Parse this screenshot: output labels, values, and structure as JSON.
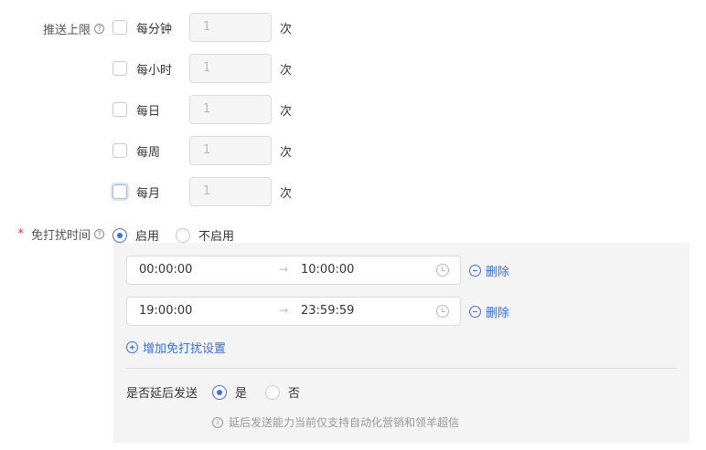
{
  "push_limit": {
    "label": "推送上限",
    "help_icon": "question-circle-icon",
    "rows": [
      {
        "period": "每分钟",
        "value": "1",
        "unit": "次",
        "checked": false
      },
      {
        "period": "每小时",
        "value": "1",
        "unit": "次",
        "checked": false
      },
      {
        "period": "每日",
        "value": "1",
        "unit": "次",
        "checked": false
      },
      {
        "period": "每周",
        "value": "1",
        "unit": "次",
        "checked": false
      },
      {
        "period": "每月",
        "value": "1",
        "unit": "次",
        "checked": false
      }
    ]
  },
  "dnd": {
    "required_mark": "*",
    "label": "免打扰时间",
    "help_icon": "question-circle-icon",
    "options": [
      {
        "label": "启用",
        "selected": true
      },
      {
        "label": "不启用",
        "selected": false
      }
    ],
    "ranges": [
      {
        "start": "00:00:00",
        "separator": "→",
        "end": "10:00:00",
        "delete_label": "删除"
      },
      {
        "start": "19:00:00",
        "separator": "→",
        "end": "23:59:59",
        "delete_label": "删除"
      }
    ],
    "add_label": "增加免打扰设置",
    "delay": {
      "label": "是否延后发送",
      "options": [
        {
          "label": "是",
          "selected": true
        },
        {
          "label": "否",
          "selected": false
        }
      ],
      "hint": "延后发送能力当前仅支持自动化营销和领羊超信",
      "hint_icon": "info-circle-icon"
    }
  },
  "colors": {
    "accent": "#3d6cf0",
    "required": "#e3342f",
    "panel_bg": "#f4f4f4"
  }
}
